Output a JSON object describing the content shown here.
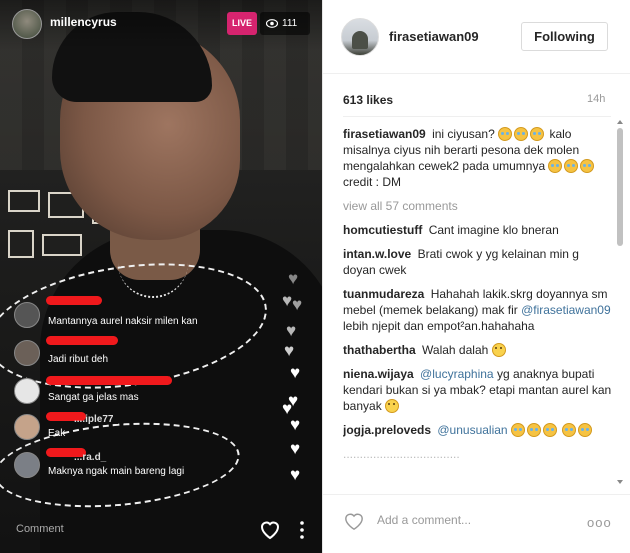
{
  "live": {
    "username": "millencyrus",
    "live_label": "LIVE",
    "viewer_count": "111",
    "comments": [
      {
        "name": "",
        "text": "Mantannya aurel naksir milen kan"
      },
      {
        "name": "",
        "text": "Jadi ribut deh"
      },
      {
        "name": "",
        "text": "Sangat ga jelas mas"
      },
      {
        "name": "....iple77",
        "text": "Eak"
      },
      {
        "name": "...ra.d_",
        "text": "Maknya ngak main bareng lagi"
      }
    ],
    "comment_placeholder": "Comment"
  },
  "post": {
    "username": "firasetiawan09",
    "follow_label": "Following",
    "likes": "613 likes",
    "age": "14h",
    "caption": {
      "user": "firasetiawan09",
      "line1": "ini ciyusan?",
      "line2": "kalo misalnya ciyus nih berarti pesona dek molen mengalahkan cewek2 pada umumnya",
      "credit": "credit : DM"
    },
    "view_all": "view all 57 comments",
    "comments": [
      {
        "user": "homcutiestuff",
        "text": "Cant imagine klo bneran"
      },
      {
        "user": "intan.w.love",
        "text": "Brati cwok y yg kelainan min g doyan cwek"
      },
      {
        "user": "tuanmudareza",
        "text_a": "Hahahah lakik.skrg doyannya sm mebel (memek belakang) mak fir",
        "mention": "@firasetiawan09",
        "text_b": "lebih njepit dan empot²an.hahahaha"
      },
      {
        "user": "thathabertha",
        "text": "Walah dalah"
      },
      {
        "user": "niena.wijaya",
        "mention": "@lucyraphina",
        "text": "yg anaknya bupati kendari bukan si ya mbak? etapi mantan aurel kan banyak"
      },
      {
        "user": "jogja.preloveds",
        "mention": "@unusualian",
        "text": ""
      },
      {
        "user": "",
        "text": "..................................."
      }
    ],
    "add_comment_placeholder": "Add a comment...",
    "more_label": "ooo"
  },
  "colors": {
    "live_badge": "#d6246f",
    "redaction": "#f0191c",
    "mention": "#3f729b"
  }
}
